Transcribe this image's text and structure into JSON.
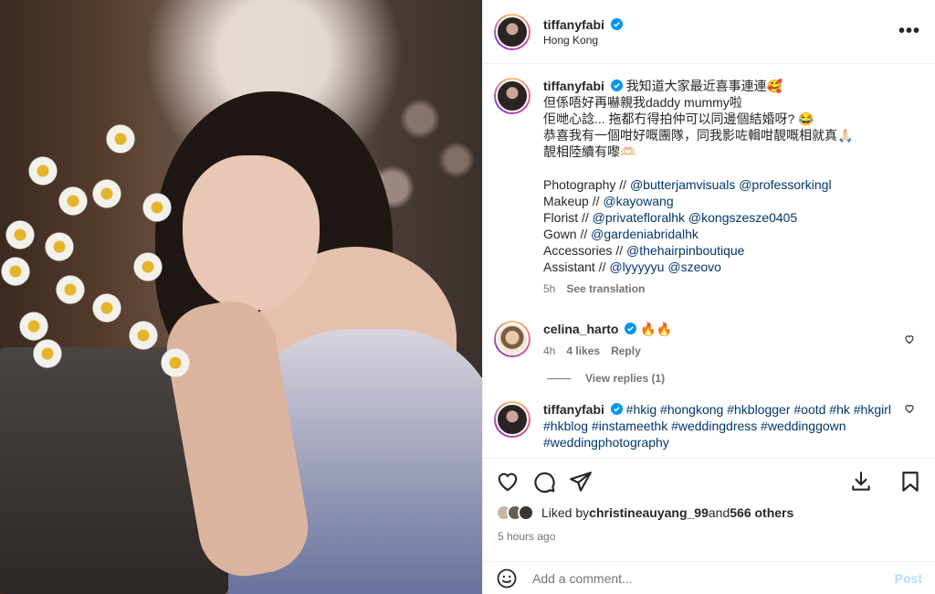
{
  "post": {
    "username": "tiffanyfabi",
    "location": "Hong Kong"
  },
  "caption": {
    "username": "tiffanyfabi",
    "lines": [
      "我知道大家最近喜事連連🥰",
      "但係唔好再嚇親我daddy mummy啦",
      "佢哋心諗... 拖都冇得拍仲可以同邊個結婚呀? 😂",
      "恭喜我有一個咁好嘅團隊，同我影咗輯咁靚嘅相就真🙏🏻",
      "靚相陸續有嚟🫶🏻"
    ],
    "credits": [
      {
        "label": "Photography // ",
        "mentions": "@butterjamvisuals @professorkingl"
      },
      {
        "label": "Makeup // ",
        "mentions": "@kayowang"
      },
      {
        "label": "Florist // ",
        "mentions": "@privatefloralhk @kongszesze0405"
      },
      {
        "label": "Gown // ",
        "mentions": "@gardeniabridalhk"
      },
      {
        "label": "Accessories // ",
        "mentions": "@thehairpinboutique"
      },
      {
        "label": "Assistant // ",
        "mentions": "@lyyyyyu @szeovo"
      }
    ],
    "time": "5h",
    "see_translation": "See translation"
  },
  "comment1": {
    "username": "celina_harto",
    "text": "🔥🔥",
    "time": "4h",
    "likes": "4 likes",
    "reply": "Reply",
    "view_replies": "View replies (1)"
  },
  "comment2": {
    "username": "tiffanyfabi",
    "text": "#hkig #hongkong #hkblogger #ootd #hk #hkgirl #hkblog #instameethk #weddingdress #weddinggown #weddingphotography"
  },
  "likes": {
    "prefix": "Liked by ",
    "user": "christineauyang_99",
    "middle": " and ",
    "others": "566 others"
  },
  "timeago": "5 hours ago",
  "add_comment": {
    "placeholder": "Add a comment...",
    "post_label": "Post"
  },
  "colors": {
    "verified": "#0095f6",
    "mention": "#00376b",
    "muted": "#737373",
    "post_disabled": "#b3dbff"
  }
}
